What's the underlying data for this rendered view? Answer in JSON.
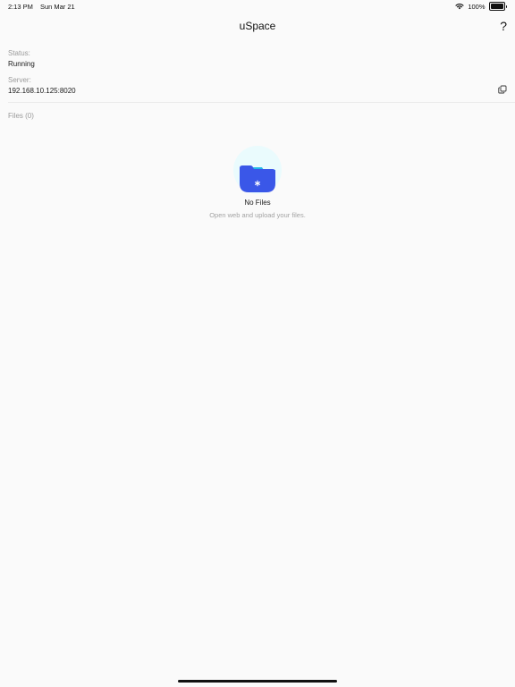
{
  "status_bar": {
    "time": "2:13 PM",
    "date": "Sun Mar 21",
    "battery_percent": "100%",
    "battery_level": 1.0,
    "wifi_icon": "wifi-icon",
    "battery_icon": "battery-icon"
  },
  "nav": {
    "title": "uSpace",
    "help_label": "?"
  },
  "status": {
    "label": "Status:",
    "value": "Running"
  },
  "server": {
    "label": "Server:",
    "value": "192.168.10.125:8020",
    "copy_icon": "copy-icon"
  },
  "files": {
    "header": "Files (0)"
  },
  "empty_state": {
    "icon": "folder-icon",
    "title": "No Files",
    "subtitle": "Open web and upload your files."
  },
  "colors": {
    "background": "#fafafa",
    "folder_blue": "#3a57e8",
    "folder_tab": "#22b8e6",
    "circle_bg": "#eafbfd",
    "muted_text": "#9a9a9a"
  }
}
